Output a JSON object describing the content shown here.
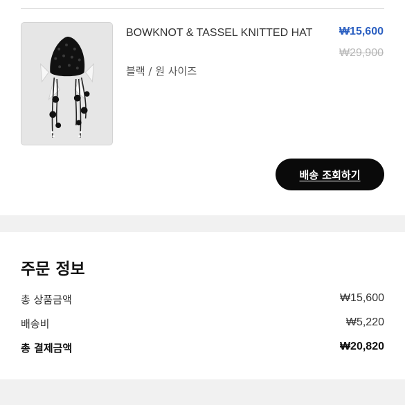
{
  "product": {
    "name": "BOWKNOT & TASSEL KNITTED HAT",
    "option": "블랙 / 원 사이즈",
    "sale_price": "₩15,600",
    "original_price": "₩29,900",
    "image_icon": "knitted-hat-photo"
  },
  "actions": {
    "track_shipping_label": "배송 조회하기"
  },
  "order_info": {
    "title": "주문 정보",
    "rows": [
      {
        "label": "총 상품금액",
        "value": "₩15,600"
      },
      {
        "label": "배송비",
        "value": "₩5,220"
      },
      {
        "label": "총 결제금액",
        "value": "₩20,820"
      }
    ]
  },
  "colors": {
    "sale_price": "#2b5fc1",
    "original_price": "#b5b5b5",
    "button_bg": "#0a0a0a",
    "section_gap": "#f1f1f1"
  }
}
